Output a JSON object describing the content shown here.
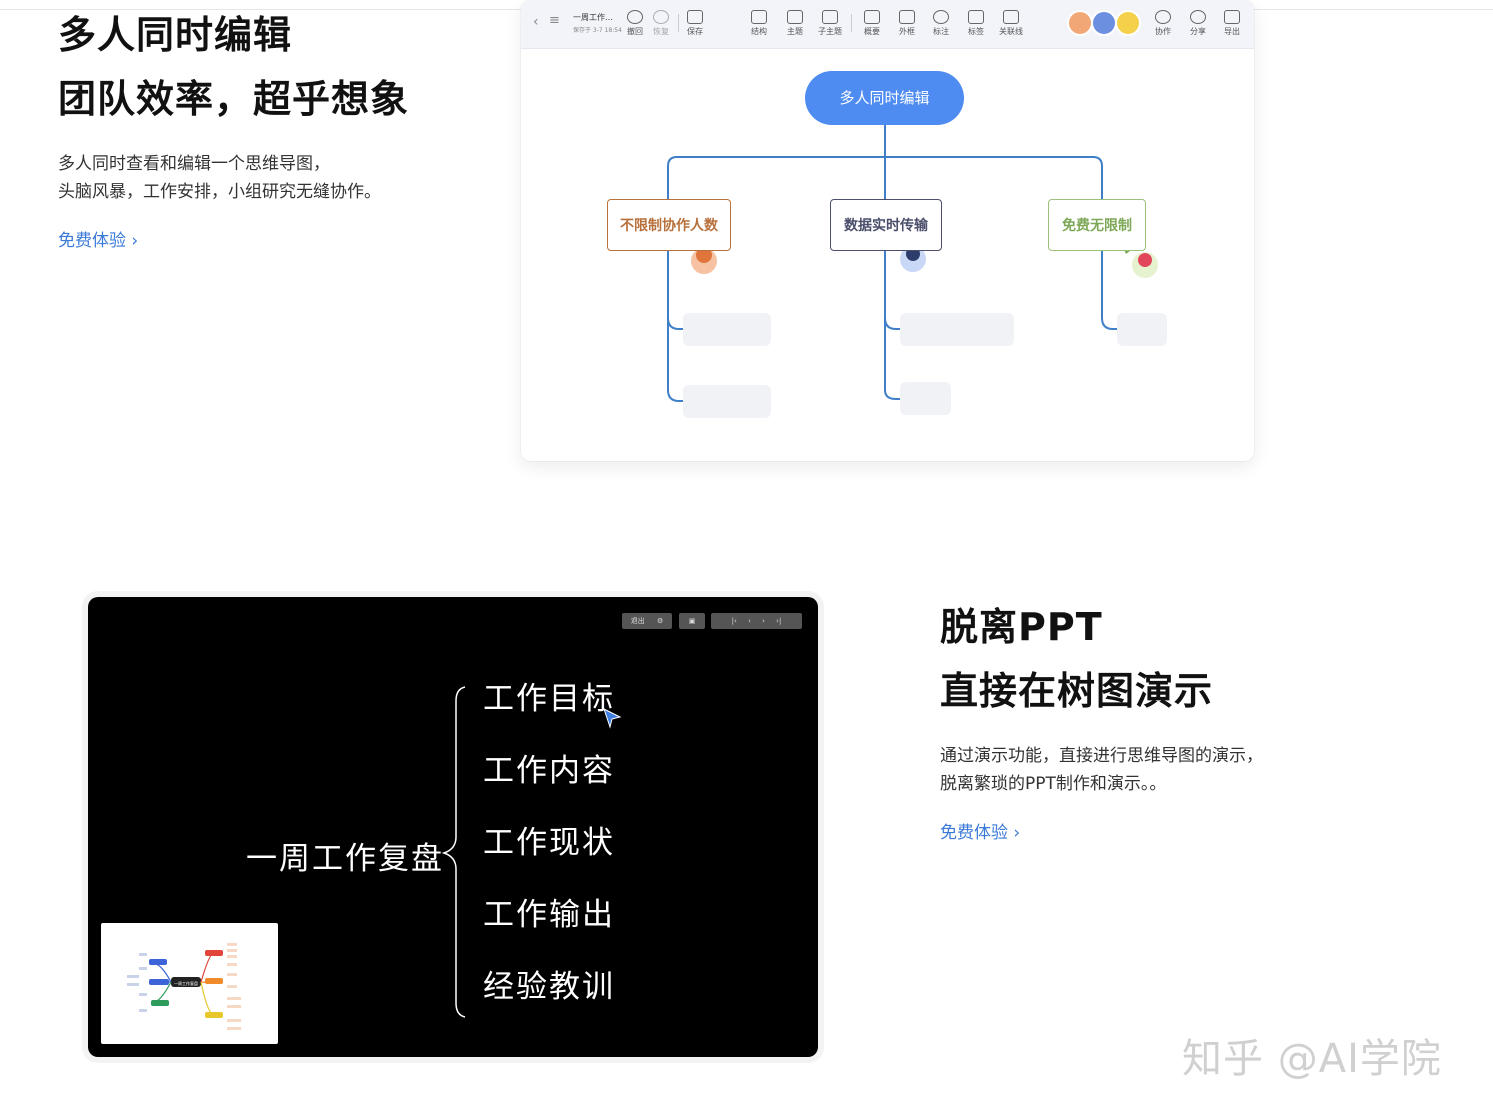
{
  "section1": {
    "title_line1": "多人同时编辑",
    "title_line2": "团队效率，超乎想象",
    "desc_line1": "多人同时查看和编辑一个思维导图，",
    "desc_line2": "头脑风暴，工作安排，小组研究无缝协作。",
    "cta": "免费体验 ›"
  },
  "editor": {
    "doc_title": "一周工作…",
    "doc_sub": "保存于 3-7 18:54",
    "toolbar": [
      {
        "icon": "undo-icon",
        "label": "撤回"
      },
      {
        "icon": "redo-icon",
        "label": "恢复"
      },
      {
        "icon": "save-icon",
        "label": "保存"
      },
      {
        "icon": "structure-icon",
        "label": "结构"
      },
      {
        "icon": "topic-icon",
        "label": "主题"
      },
      {
        "icon": "subtopic-icon",
        "label": "子主题"
      },
      {
        "icon": "summary-icon",
        "label": "概要"
      },
      {
        "icon": "frame-icon",
        "label": "外框"
      },
      {
        "icon": "note-icon",
        "label": "标注"
      },
      {
        "icon": "tag-icon",
        "label": "标签"
      },
      {
        "icon": "link-line-icon",
        "label": "关联线"
      },
      {
        "icon": "collaborate-icon",
        "label": "协作"
      },
      {
        "icon": "share-icon",
        "label": "分享"
      },
      {
        "icon": "export-icon",
        "label": "导出"
      }
    ],
    "avatar_colors": [
      "#f2a777",
      "#6d8fe0",
      "#f4d04b"
    ],
    "map": {
      "root": "多人同时编辑",
      "branches": [
        {
          "label": "不限制协作人数",
          "color": "#b8713c"
        },
        {
          "label": "数据实时传输",
          "color": "#4b4f6b"
        },
        {
          "label": "免费无限制",
          "color": "#7da857"
        }
      ],
      "line_color": "#3f7fc8",
      "root_color": "#4f8cf2"
    }
  },
  "section2": {
    "title_line1": "脱离PPT",
    "title_line2": "直接在树图演示",
    "desc_line1": "通过演示功能，直接进行思维导图的演示，",
    "desc_line2": "脱离繁琐的PPT制作和演示。。",
    "cta": "免费体验 ›"
  },
  "presentation": {
    "exit_label": "退出",
    "root": "一周工作复盘",
    "thumb_root": "一周工作复盘",
    "items": [
      "工作目标",
      "工作内容",
      "工作现状",
      "工作输出",
      "经验教训"
    ]
  },
  "watermark": "知乎 @AI学院"
}
